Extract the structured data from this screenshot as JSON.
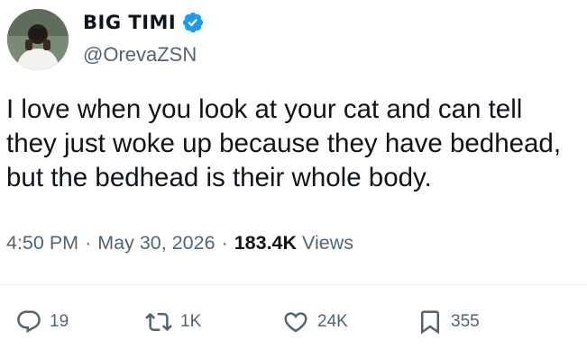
{
  "author": {
    "display_name": "BIG TIMI",
    "handle": "@OrevaZSN",
    "verified": true,
    "avatar_icon": "avatar-photo"
  },
  "tweet": {
    "text": "I love when you look at your cat and can tell\nthey just woke up because they have bedhead,\nbut the bedhead is their whole body.",
    "time": "4:50 PM",
    "date": "May 30, 2026",
    "views_count": "183.4K",
    "views_label": "Views",
    "separator": "·"
  },
  "actions": {
    "replies": "19",
    "retweets": "1K",
    "likes": "24K",
    "bookmarks": "355"
  },
  "colors": {
    "verified_blue": "#1d9bf0",
    "text_primary": "#0f1419",
    "text_secondary": "#536471",
    "divider": "#eff3f4"
  }
}
